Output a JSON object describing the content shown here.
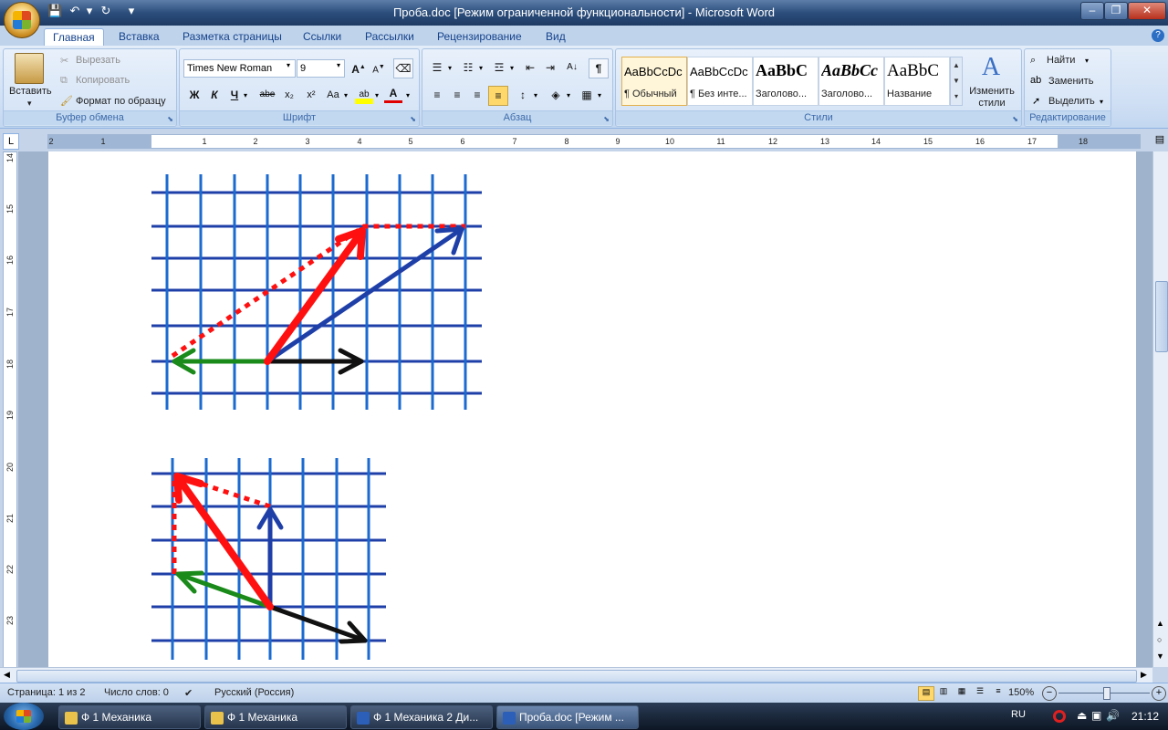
{
  "window": {
    "title": "Проба.doc [Режим ограниченной функциональности] - Microsoft Word"
  },
  "ribbon_tabs": [
    "Главная",
    "Вставка",
    "Разметка страницы",
    "Ссылки",
    "Рассылки",
    "Рецензирование",
    "Вид"
  ],
  "clipboard": {
    "paste": "Вставить",
    "cut": "Вырезать",
    "copy": "Копировать",
    "format_painter": "Формат по образцу",
    "label": "Буфер обмена"
  },
  "font": {
    "name": "Times New Roman",
    "size": "9",
    "label": "Шрифт",
    "bold": "Ж",
    "italic": "К",
    "underline": "Ч",
    "strike": "abe",
    "subscript": "x₂",
    "superscript": "x²",
    "case": "Aa"
  },
  "paragraph": {
    "label": "Абзац"
  },
  "styles": {
    "label": "Стили",
    "items": [
      {
        "sample": "AaBbCcDc",
        "name": "¶ Обычный"
      },
      {
        "sample": "AaBbCcDc",
        "name": "¶ Без инте..."
      },
      {
        "sample": "AaBbC",
        "name": "Заголово..."
      },
      {
        "sample": "AaBbCc",
        "name": "Заголово..."
      },
      {
        "sample": "AaBbC",
        "name": "Название"
      }
    ],
    "change_styles": "Изменить стили"
  },
  "editing": {
    "label": "Редактирование",
    "find": "Найти",
    "replace": "Заменить",
    "select": "Выделить"
  },
  "ruler": {
    "h_ticks": [
      "2",
      "1",
      "1",
      "2",
      "3",
      "4",
      "5",
      "6",
      "7",
      "8",
      "9",
      "10",
      "11",
      "12",
      "13",
      "14",
      "15",
      "16",
      "17",
      "18"
    ],
    "v_ticks": [
      "14",
      "15",
      "16",
      "17",
      "18",
      "19",
      "20",
      "21",
      "22",
      "23"
    ]
  },
  "status": {
    "page": "Страница: 1 из 2",
    "words": "Число слов: 0",
    "language": "Русский (Россия)",
    "zoom": "150%"
  },
  "taskbar": {
    "items": [
      "Ф 1 Механика",
      "Ф 1 Механика",
      "Ф 1 Механика 2 Ди...",
      "Проба.doc [Режим ..."
    ],
    "lang": "RU",
    "time": "21:12"
  }
}
